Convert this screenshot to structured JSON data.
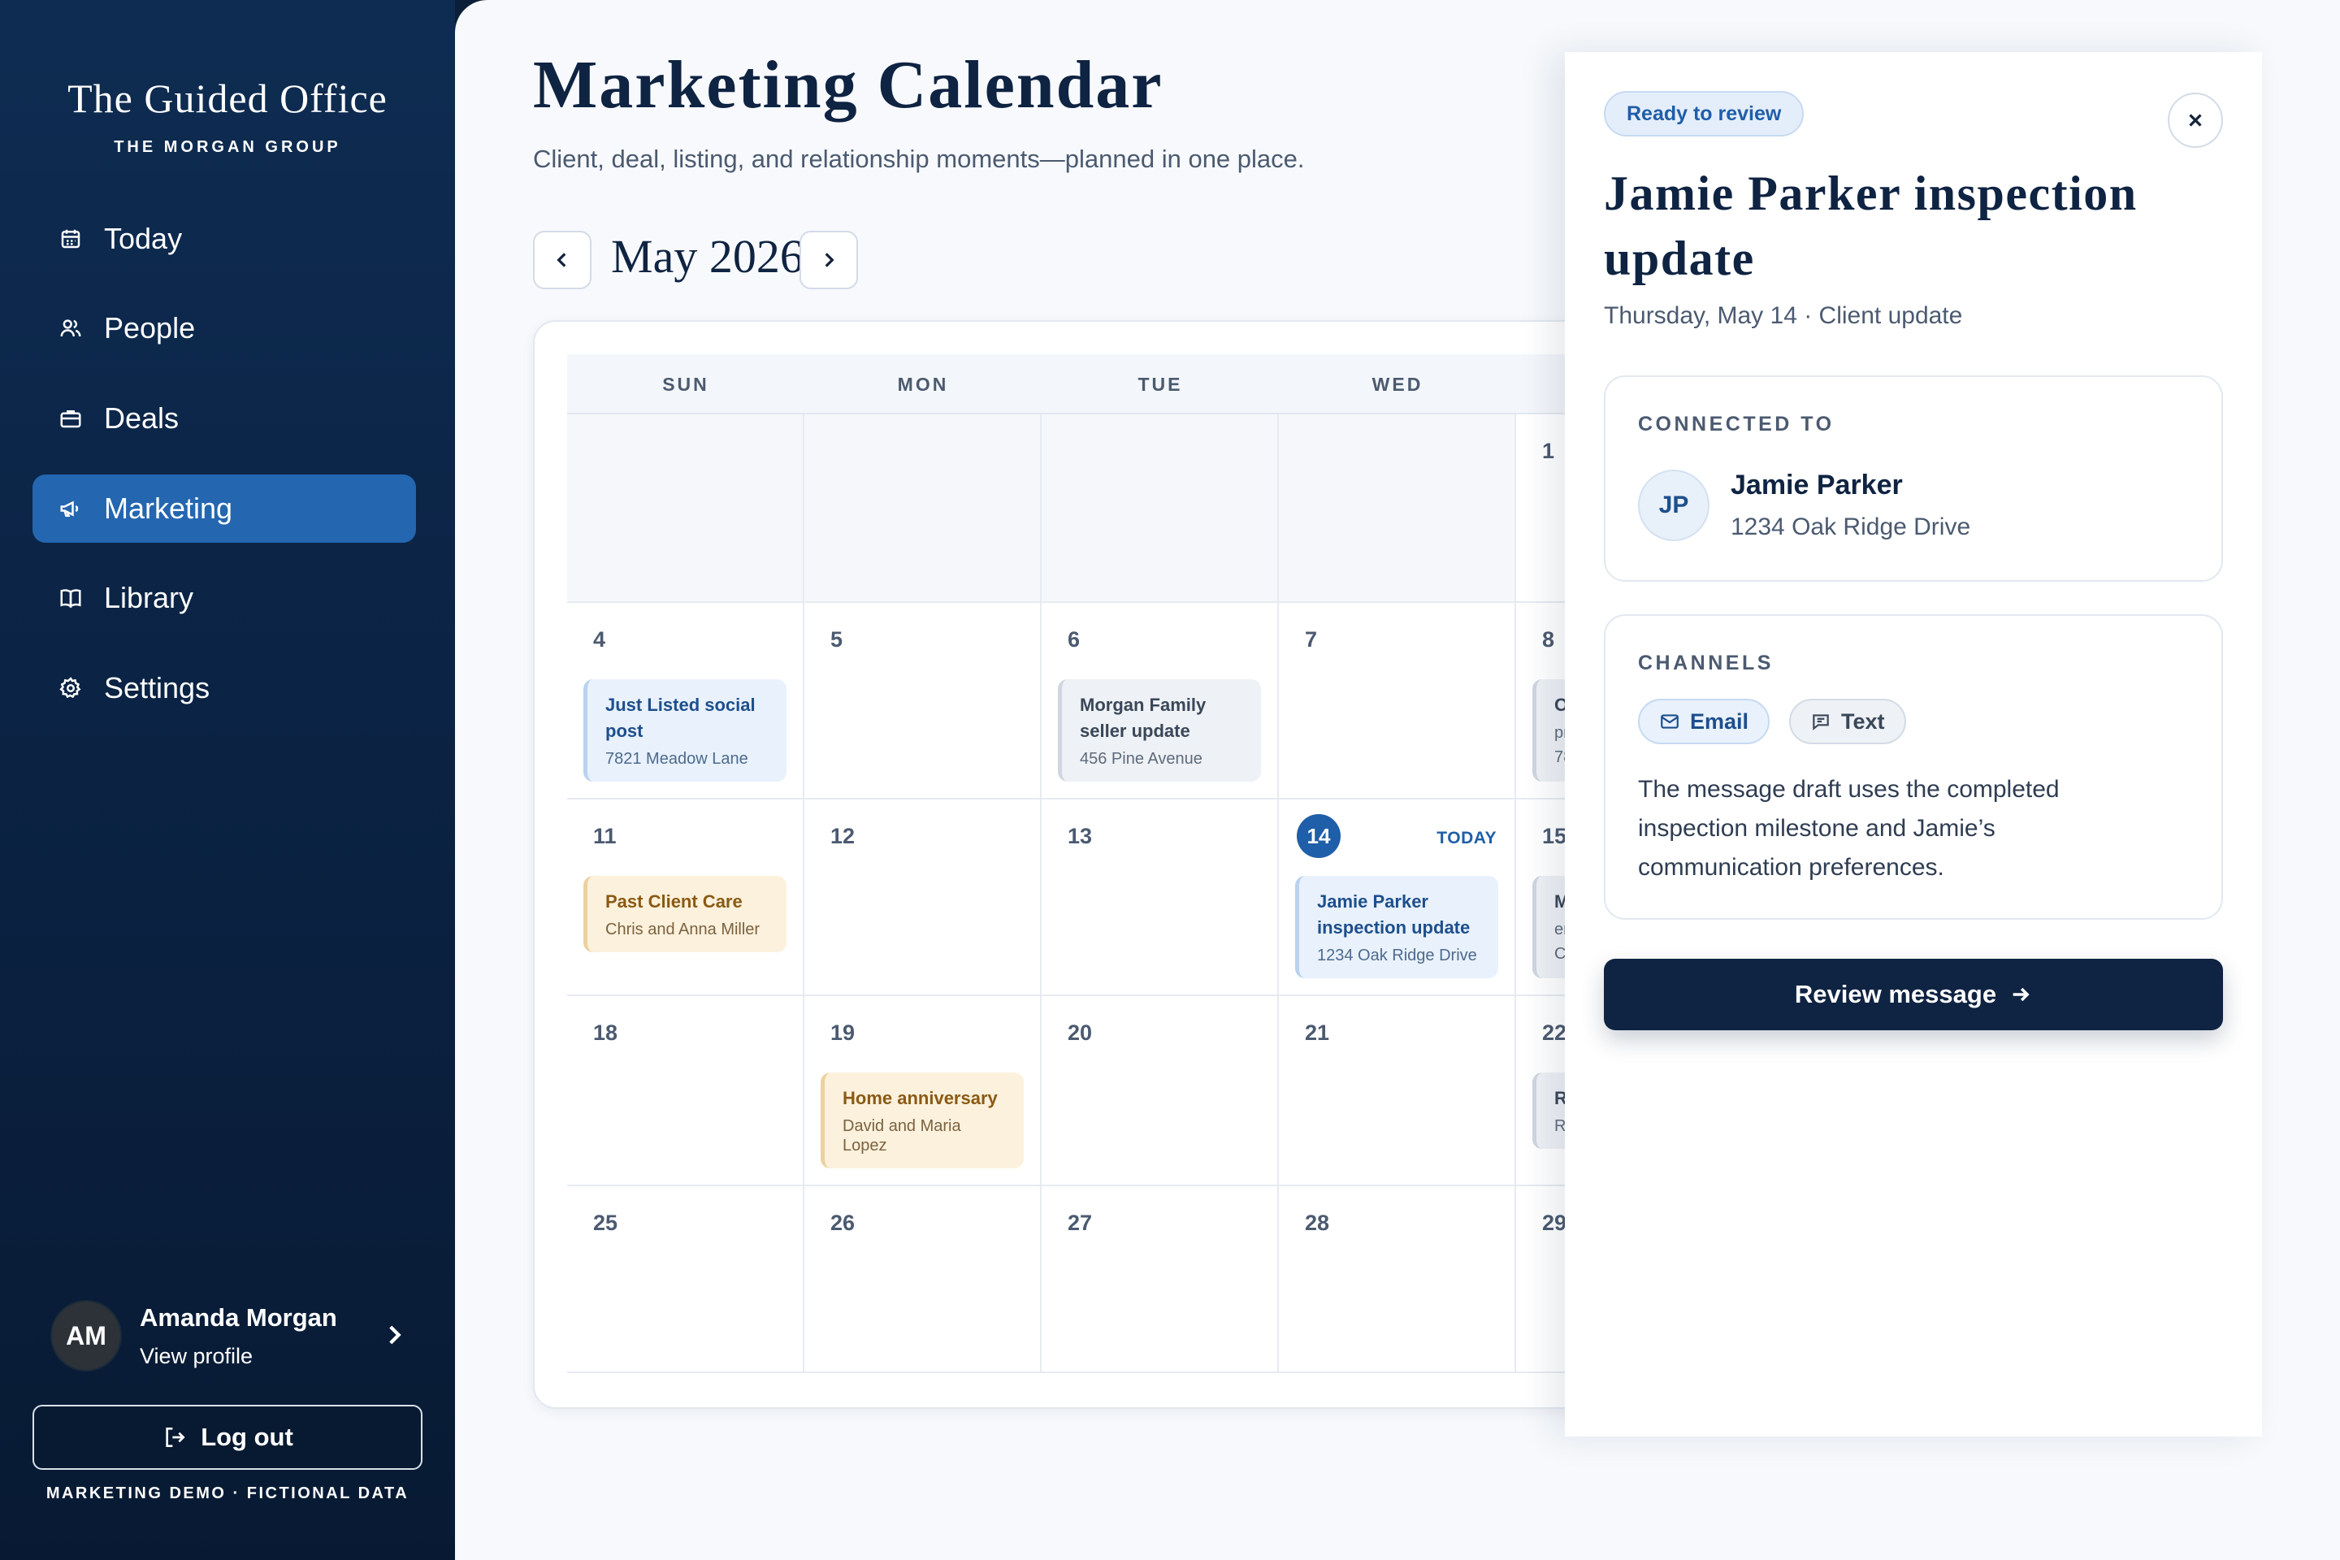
{
  "sidebar": {
    "brand_title": "The Guided Office",
    "brand_subtitle": "THE MORGAN GROUP",
    "nav": [
      {
        "label": "Today",
        "icon": "calendar-icon",
        "active": false
      },
      {
        "label": "People",
        "icon": "people-icon",
        "active": false
      },
      {
        "label": "Deals",
        "icon": "briefcase-icon",
        "active": false
      },
      {
        "label": "Marketing",
        "icon": "megaphone-icon",
        "active": true
      },
      {
        "label": "Library",
        "icon": "book-icon",
        "active": false
      },
      {
        "label": "Settings",
        "icon": "gear-icon",
        "active": false
      }
    ],
    "profile": {
      "initials": "AM",
      "name": "Amanda Morgan",
      "link": "View profile"
    },
    "logout_label": "Log out",
    "demo_note": "MARKETING DEMO · FICTIONAL DATA"
  },
  "main": {
    "title": "Marketing Calendar",
    "subtitle": "Client, deal, listing, and relationship moments—planned in one place.",
    "month_label": "May 2026",
    "weekdays": [
      "SUN",
      "MON",
      "TUE",
      "WED"
    ],
    "day_numbers": {
      "w0": [
        "",
        "",
        "",
        "",
        "1"
      ],
      "w1": [
        "4",
        "5",
        "6",
        "7",
        "8"
      ],
      "w2": [
        "11",
        "12",
        "13",
        "14",
        "15"
      ],
      "w3": [
        "18",
        "19",
        "20",
        "21",
        "22"
      ],
      "w4": [
        "25",
        "26",
        "27",
        "28",
        "29"
      ]
    },
    "today_label": "TODAY",
    "events": {
      "e1": {
        "title": "Just Listed social post",
        "subtitle": "7821 Meadow Lane"
      },
      "e2": {
        "title": "Morgan Family seller update",
        "subtitle": "456 Pine Avenue"
      },
      "e3": {
        "title": "Past Client Care",
        "subtitle": "Chris and Anna Miller"
      },
      "e4": {
        "title": "Jamie Parker inspection update",
        "subtitle": "1234 Oak Ridge Drive"
      },
      "e5": {
        "title": "Home anniversary",
        "subtitle": "David and Maria Lopez"
      },
      "p8": {
        "title": "O",
        "subtitle": "pr",
        "extra": "78"
      },
      "p15": {
        "title": "M",
        "subtitle": "er",
        "extra": "C"
      },
      "p22": {
        "title": "R",
        "subtitle": "R"
      }
    }
  },
  "panel": {
    "status": "Ready to review",
    "title": "Jamie Parker inspection update",
    "meta": "Thursday, May 14 · Client update",
    "connected": {
      "label": "CONNECTED TO",
      "initials": "JP",
      "name": "Jamie Parker",
      "address": "1234 Oak Ridge Drive"
    },
    "channels": {
      "label": "CHANNELS",
      "email": "Email",
      "text": "Text",
      "note": "The message draft uses the completed inspection milestone and Jamie’s communication preferences."
    },
    "review_label": "Review message"
  },
  "colors": {
    "sidebar_bg": "#0e2c52",
    "active_nav": "#2466b0",
    "primary_dark": "#0f2342",
    "accent_blue": "#1f5ea8",
    "event_blue_bg": "#e8f1fc",
    "event_amber_bg": "#fcf1dc",
    "event_gray_bg": "#eef1f5"
  }
}
